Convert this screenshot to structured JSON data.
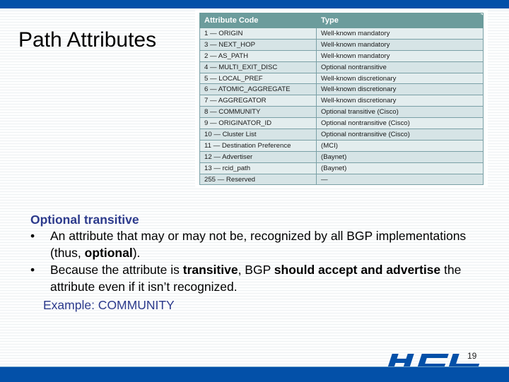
{
  "slide": {
    "title": "Path Attributes",
    "page_number": "19",
    "brand": "HCL",
    "colors": {
      "brand_blue": "#0350a8",
      "table_header": "#6c9c9c",
      "subhead": "#2c3a8c"
    }
  },
  "table": {
    "headers": [
      "Attribute Code",
      "Type"
    ],
    "rows": [
      [
        "1 — ORIGIN",
        "Well-known mandatory"
      ],
      [
        "3 — NEXT_HOP",
        "Well-known mandatory"
      ],
      [
        "2 — AS_PATH",
        "Well-known mandatory"
      ],
      [
        "4 — MULTI_EXIT_DISC",
        "Optional nontransitive"
      ],
      [
        "5 — LOCAL_PREF",
        "Well-known discretionary"
      ],
      [
        "6 — ATOMIC_AGGREGATE",
        "Well-known discretionary"
      ],
      [
        "7 — AGGREGATOR",
        "Well-known discretionary"
      ],
      [
        "8 — COMMUNITY",
        "Optional transitive (Cisco)"
      ],
      [
        "9 — ORIGINATOR_ID",
        "Optional nontransitive (Cisco)"
      ],
      [
        "10 — Cluster List",
        "Optional nontransitive (Cisco)"
      ],
      [
        "11 — Destination Preference",
        "(MCI)"
      ],
      [
        "12 — Advertiser",
        "(Baynet)"
      ],
      [
        "13 — rcid_path",
        "(Baynet)"
      ],
      [
        "255 — Reserved",
        "—"
      ]
    ]
  },
  "body": {
    "subhead": "Optional transitive",
    "bullet_char": "•",
    "bullet1": {
      "part1": "An attribute that may or may not be, recognized by all BGP implementations (thus, ",
      "bold1": "optional",
      "part2": ")."
    },
    "bullet2": {
      "part1": "Because the attribute is ",
      "bold1": "transitive",
      "part2": ", BGP ",
      "bold2": "should accept and advertise",
      "part3": " the attribute even if it isn’t recognized."
    },
    "example": "Example: COMMUNITY"
  }
}
